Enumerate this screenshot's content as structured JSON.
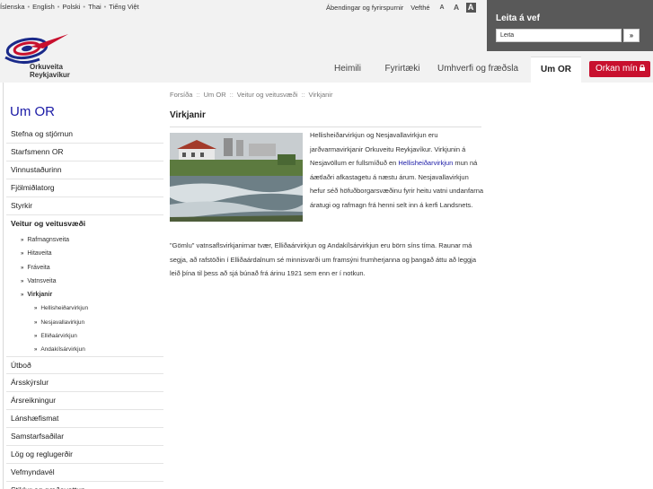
{
  "header": {
    "languages": [
      "Íslenska",
      "English",
      "Polski",
      "Thai",
      "Tiếng Việt"
    ],
    "lang_separator": "•",
    "feedback_link": "Ábendingar og fyrirspurnir",
    "about_web_link": "Vefthé",
    "font_small": "A",
    "font_medium": "A",
    "font_large": "A"
  },
  "search": {
    "title": "Leita á vef",
    "placeholder": "Leita",
    "value": "Leita",
    "button_label": "»"
  },
  "logo": {
    "line1": "Orkuveita",
    "line2": "Reykjavíkur"
  },
  "nav": {
    "items": [
      "Heimili",
      "Fyrirtæki",
      "Umhverfi og fræðsla",
      "Um OR"
    ],
    "active": "Um OR",
    "orkan_label": "Orkan mín"
  },
  "sidebar": {
    "title": "Um OR",
    "items_top": [
      "Stefna og stjórnun",
      "Starfsmenn OR",
      "Vinnustaðurinn",
      "Fjölmiðlatorg",
      "Styrkir"
    ],
    "active_item": "Veitur og veitusvæði",
    "sub_items": [
      "Rafmagnsveita",
      "Hitaveita",
      "Fráveita",
      "Vatnsveita"
    ],
    "sub_active": "Virkjanir",
    "subsub_items": [
      "Hellisheiðarvirkjun",
      "Nesjavallavirkjun",
      "Elliðaárvirkjun",
      "Andakílsárvirkjun"
    ],
    "items_bottom": [
      "Útboð",
      "Ársskýrslur",
      "Ársreikningur",
      "Lánshæfismat",
      "Samstarfsaðilar",
      "Lög og reglugerðir",
      "Vefmyndavél",
      "Stiklur og gæðavottun"
    ],
    "arrow": "»"
  },
  "content": {
    "breadcrumb": [
      "Forsíða",
      "Um OR",
      "Veitur og veitusvæði",
      "Virkjanir"
    ],
    "breadcrumb_sep": "::",
    "title": "Virkjanir",
    "para1_a": "Hellisheiðarvirkjun og Nesjavallavirkjun eru jarðvarmavirkjanir Orkuveitu Reykjavíkur. Virkjunin á Nesjavöllum er fullsmíðuð en ",
    "para1_link": "Hellisheiðarvirkjun",
    "para1_b": " mun ná áætlaðri afkastagetu á næstu árum. Nesjavallavirkjun hefur séð höfuðborgarsvæðinu fyrir heitu vatni undanfarna áratugi og rafmagn frá henni selt inn á kerfi Landsnets.",
    "para2": "\"Gömlu\" vatnsaflsvirkjanirnar tvær, Elliðaárvirkjun og Andakílsárvirkjun eru börn síns tíma. Raunar má segja, að rafstöðin í Elliðaárdalnum sé minnisvarði um framsýni frumherjanna og þangað áttu að leggja leið þína til þess að sjá búnað frá árinu 1921 sem enn er í notkun."
  },
  "colors": {
    "accent_red": "#c8102e",
    "link_blue": "#1a1aa6",
    "header_bg": "#f2f2f2",
    "search_bg": "#595959"
  }
}
